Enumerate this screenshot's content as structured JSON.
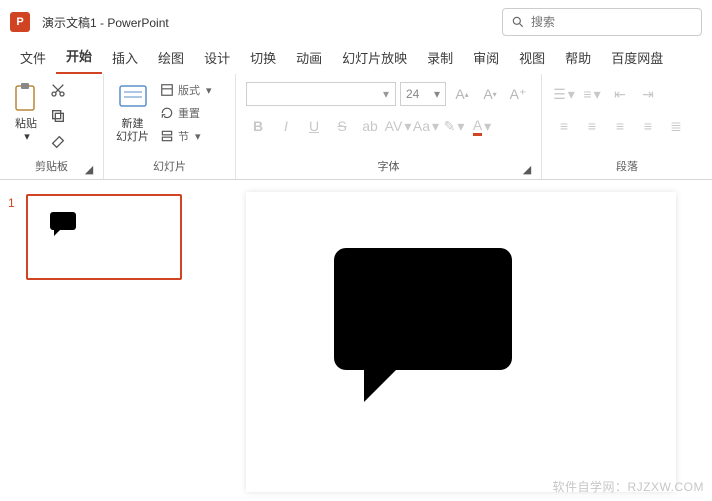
{
  "title": {
    "doc": "演示文稿1",
    "sep": "  -  ",
    "app": "PowerPoint"
  },
  "search": {
    "placeholder": "搜索"
  },
  "tabs": {
    "file": "文件",
    "home": "开始",
    "insert": "插入",
    "draw": "绘图",
    "design": "设计",
    "transition": "切换",
    "animation": "动画",
    "slideshow": "幻灯片放映",
    "record": "录制",
    "review": "审阅",
    "view": "视图",
    "help": "帮助",
    "baidu": "百度网盘"
  },
  "groups": {
    "clipboard": {
      "label": "剪贴板",
      "paste": "粘贴"
    },
    "slides": {
      "label": "幻灯片",
      "new_slide": "新建\n幻灯片",
      "layout": "版式",
      "reset": "重置",
      "section": "节"
    },
    "font": {
      "label": "字体",
      "size": "24"
    },
    "paragraph": {
      "label": "段落"
    }
  },
  "thumb": {
    "index": "1"
  },
  "watermark": "软件自学网：RJZXW.COM"
}
